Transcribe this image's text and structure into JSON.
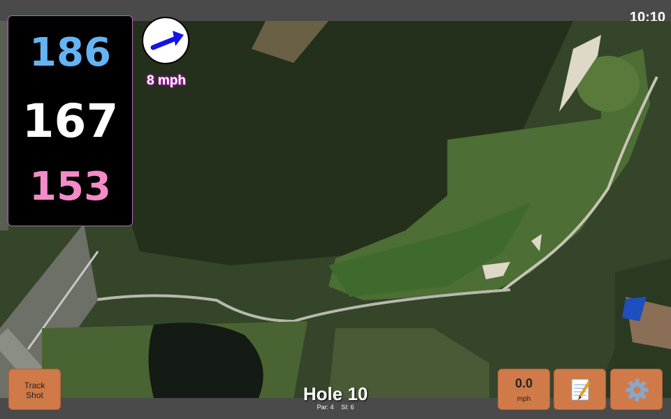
{
  "status": {
    "time": "10:10"
  },
  "distances": {
    "back": "186",
    "middle": "167",
    "front": "153",
    "colors": {
      "back": "#64b4f4",
      "middle": "#ffffff",
      "front": "#f48ac8"
    }
  },
  "wind": {
    "speed": "8 mph",
    "direction_icon": "arrow-northeast-icon"
  },
  "buttons": {
    "track_shot_line1": "Track",
    "track_shot_line2": "Shot",
    "speed_value": "0.0",
    "speed_unit": "mph",
    "notes_icon": "notepad-icon",
    "settings_icon": "gear-icon"
  },
  "hole": {
    "title": "Hole 10",
    "par": "Par: 4",
    "si": "SI: 6"
  },
  "colors": {
    "accent": "#cf7a48",
    "frame": "#b06ab0"
  }
}
